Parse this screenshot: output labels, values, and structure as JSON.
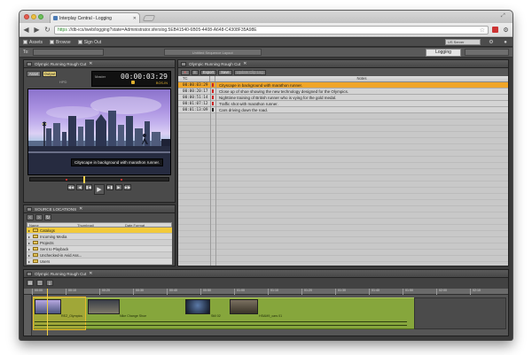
{
  "browser": {
    "tab_title": "Interplay Central - Logging",
    "url_https": "https",
    "url_rest": "://db-ics/iweb/logging?state=Administrator.sferslog.5EB41540-6B05-4408-A648-C4308F35A98E"
  },
  "header": {
    "checkbox1": "Assets",
    "checkbox2": "Browse",
    "checkbox3": "Sign Out",
    "server": "US Server",
    "to_label": "To:",
    "middle_tab": "Untitled Sequence Layout",
    "logging_tab": "Logging"
  },
  "player": {
    "header": "Olympic Running Rough Cut",
    "mode_source": "Asset",
    "mode_record": "Output",
    "std": "HPD",
    "tc_label": "Master",
    "timecode": "00:00:03:29",
    "tc_sub": "BOS-IN",
    "caption": "Cityscape in background with marathon runner.",
    "transport_row1": [
      "◀◀",
      "◀",
      "▮◀",
      "▶▮",
      "▶",
      "▶▶"
    ],
    "transport_row2": [
      "⇤",
      "⊣",
      "⊢",
      "⇥",
      "⟲",
      "⟳"
    ],
    "play": "▶"
  },
  "source_browser": {
    "header": "SOURCE LOCATIONS",
    "columns": [
      "Name",
      "Thumbnail",
      "Date Format"
    ],
    "items": [
      {
        "label": "Catalogs",
        "selected": true
      },
      {
        "label": "Incoming Media",
        "selected": false
      },
      {
        "label": "Projects",
        "selected": false
      },
      {
        "label": "Sent to Playback",
        "selected": false
      },
      {
        "label": "Unchecked-in Avid Ass...",
        "selected": false
      },
      {
        "label": "Users",
        "selected": false
      }
    ]
  },
  "log": {
    "header": "Olympic Running Rough Cut",
    "tools": [
      "✕",
      "≡",
      "Export",
      "Save",
      "Update Clip Log"
    ],
    "col_tc": "TC",
    "col_notes": "Notes",
    "rows": [
      {
        "tc": "00:00:03:29",
        "color": "#cc2222",
        "note": "Cityscape in background with marathon runner.",
        "selected": true
      },
      {
        "tc": "00:00:20:17",
        "color": "#cc2222",
        "note": "Close up of shoe showing the new technology designed for the Olympics.",
        "selected": false
      },
      {
        "tc": "00:00:51:14",
        "color": "#cc2222",
        "note": "Nighttime training of British runner who is vying for the gold medal.",
        "selected": false
      },
      {
        "tc": "00:01:07:12",
        "color": "#cc2222",
        "note": "Traffic shot with marathon runner.",
        "selected": false
      },
      {
        "tc": "00:01:13:09",
        "color": "#222222",
        "note": "Cars driving down the road.",
        "selected": false
      }
    ]
  },
  "timeline": {
    "header": "Olympic Running Rough Cut",
    "ruler": [
      "00:00",
      "00:10",
      "00:20",
      "00:30",
      "00:40",
      "00:50",
      "01:00",
      "01:10",
      "01:20",
      "01:30",
      "01:40",
      "01:50",
      "02:00",
      "02:10"
    ],
    "clip_labels": [
      "REZ_Olympics",
      "Nike Change Shoe",
      "Still 02",
      "HSAM9_cars 01"
    ]
  },
  "colors": {
    "selection_orange": "#f0a528",
    "folder_yellow": "#f2ca3a",
    "timeline_green": "#86a63c",
    "playhead": "#f5d040"
  }
}
